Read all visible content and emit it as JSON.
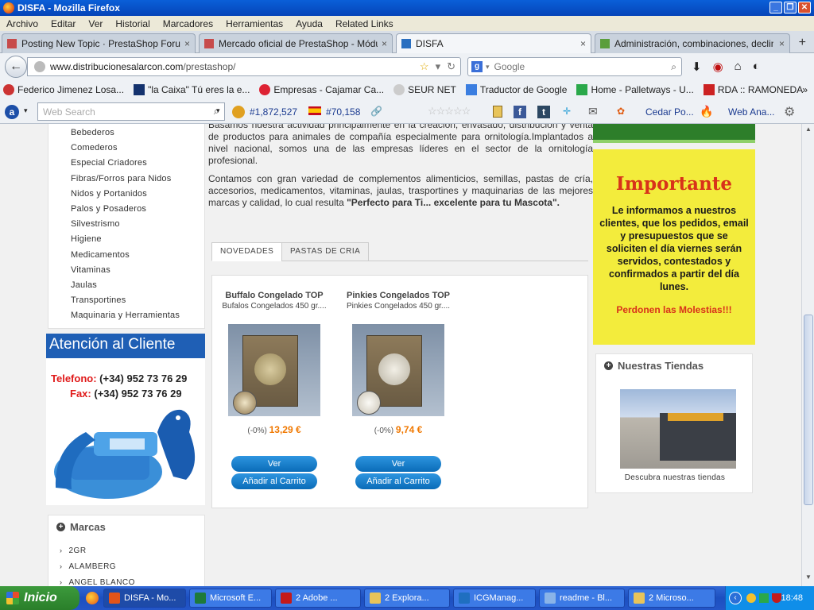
{
  "window": {
    "title": "DISFA - Mozilla Firefox"
  },
  "menu": [
    "Archivo",
    "Editar",
    "Ver",
    "Historial",
    "Marcadores",
    "Herramientas",
    "Ayuda",
    "Related Links"
  ],
  "tabs": [
    {
      "label": "Posting New Topic · PrestaShop Forums",
      "active": false
    },
    {
      "label": "Mercado oficial de PrestaShop - Módulos ...",
      "active": false
    },
    {
      "label": "DISFA",
      "active": true
    },
    {
      "label": "Administración, combinaciones, declinacio...",
      "active": false
    }
  ],
  "nav": {
    "url_host": "www.distribucionesalarcon.com",
    "url_path": "/prestashop/",
    "search_placeholder": "Google"
  },
  "bookmarks": [
    "Federico Jimenez Losa...",
    "\"la Caixa\" Tú eres la e...",
    "Empresas - Cajamar Ca...",
    "SEUR NET",
    "Traductor de Google",
    "Home - Palletways - U...",
    "RDA :: RAMONEDA"
  ],
  "addon": {
    "search_placeholder": "Web Search",
    "rank1": "#1,872,527",
    "rank2": "#70,158",
    "cedar": "Cedar Po...",
    "webana": "Web Ana..."
  },
  "categories": [
    "Bebederos",
    "Comederos",
    "Especial Criadores",
    "Fibras/Forros para Nidos",
    "Nidos y Portanidos",
    "Palos y Posaderos",
    "Silvestrismo",
    "Higiene",
    "Medicamentos",
    "Vitaminas",
    "Jaulas",
    "Transportines",
    "Maquinaria y Herramientas"
  ],
  "contact": {
    "header": "Atención al Cliente",
    "tel_label": "Telefono:",
    "tel": "(+34) 952 73 76 29",
    "fax_label": "Fax:",
    "fax": "(+34) 952 73 76 29"
  },
  "brands": {
    "title": "Marcas",
    "items": [
      "2GR",
      "ALAMBERG",
      "ANGEL BLANCO"
    ]
  },
  "about": {
    "p1": "Basamos nuestra actividad principalmente en la creación, envasado, distribución y venta de productos para animales de compañía especialmente para ornitología.Implantados a nivel nacional,  somos una de las empresas líderes en el sector de la ornitología profesional.",
    "p2_start": "Contamos con  gran variedad de complementos alimenticios, semillas, pastas de cría, accesorios, medicamentos, vitaminas, jaulas, trasportines y maquinarias de las mejores marcas y calidad, lo cual resulta ",
    "p2_bold": "\"Perfecto para Ti... excelente para tu Mascota\"."
  },
  "product_tabs": [
    "NOVEDADES",
    "PASTAS DE CRIA"
  ],
  "products": [
    {
      "name": "Buffalo Congelado TOP",
      "desc": "Bufalos Congelados 450 gr....",
      "discount": "(-0%)",
      "price": "13,29 €",
      "view": "Ver",
      "cart": "Añadir al Carrito"
    },
    {
      "name": "Pinkies Congelados TOP",
      "desc": "Pinkies Congelados 450 gr....",
      "discount": "(-0%)",
      "price": "9,74 €",
      "view": "Ver",
      "cart": "Añadir al Carrito"
    }
  ],
  "notice": {
    "title": "Importante",
    "body": "Le informamos a nuestros clientes, que los pedidos, email y presupuestos que se soliciten el día viernes serán servidos, contestados y confirmados a partir del día lunes.",
    "sorry": "Perdonen las Molestias!!!"
  },
  "stores": {
    "title": "Nuestras Tiendas",
    "caption": "Descubra nuestras tiendas"
  },
  "taskbar": {
    "start": "Inicio",
    "tasks": [
      "DISFA - Mo...",
      "Microsoft E...",
      "2 Adobe ...",
      "2 Explora...",
      "ICGManag...",
      "readme - Bl...",
      "2 Microso..."
    ],
    "clock": "18:48"
  },
  "colors": {
    "accent_orange": "#f07800",
    "notice_bg": "#f3ec3c",
    "notice_red": "#d8321a",
    "button_blue": "#0a6cb8"
  }
}
